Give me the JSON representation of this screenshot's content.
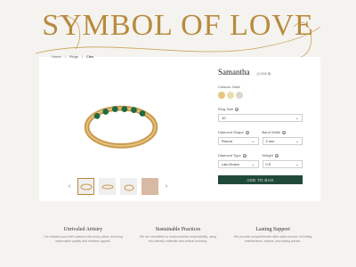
{
  "hero": {
    "title": "SYMBOL OF LOVE",
    "accent_color": "#b88a3e"
  },
  "breadcrumb": {
    "items": [
      "Home",
      "Rings",
      "Cleo"
    ]
  },
  "product": {
    "title": "Samantha",
    "price": "(1,000 $)",
    "colour_label": "Colours: Gold",
    "colours": [
      "#e2c67a",
      "#eddcab",
      "#ddd6c9"
    ],
    "ring_size": {
      "label": "Ring Size",
      "value": "10"
    },
    "diamond_shape": {
      "label": "Diamond Shape",
      "value": "Round"
    },
    "band_width": {
      "label": "Band Width",
      "value": "2 mm"
    },
    "diamond_type": {
      "label": "Diamond Type",
      "value": "Lab-Grown"
    },
    "weight": {
      "label": "Weight",
      "value": "0.5"
    },
    "cta": "ADD TO BAG"
  },
  "features": [
    {
      "title": "Unrivaled Artistry",
      "text": "Our artisans pour their passion into every piece, ensuring impeccable quality and timeless appeal."
    },
    {
      "title": "Sustainable Practices",
      "text": "We are committed to environmental responsibility, using eco-friendly materials and ethical sourcing."
    },
    {
      "title": "Lasting Support",
      "text": "We provide comprehensive after-sales service, including maintenance, repairs, and styling advice."
    }
  ]
}
